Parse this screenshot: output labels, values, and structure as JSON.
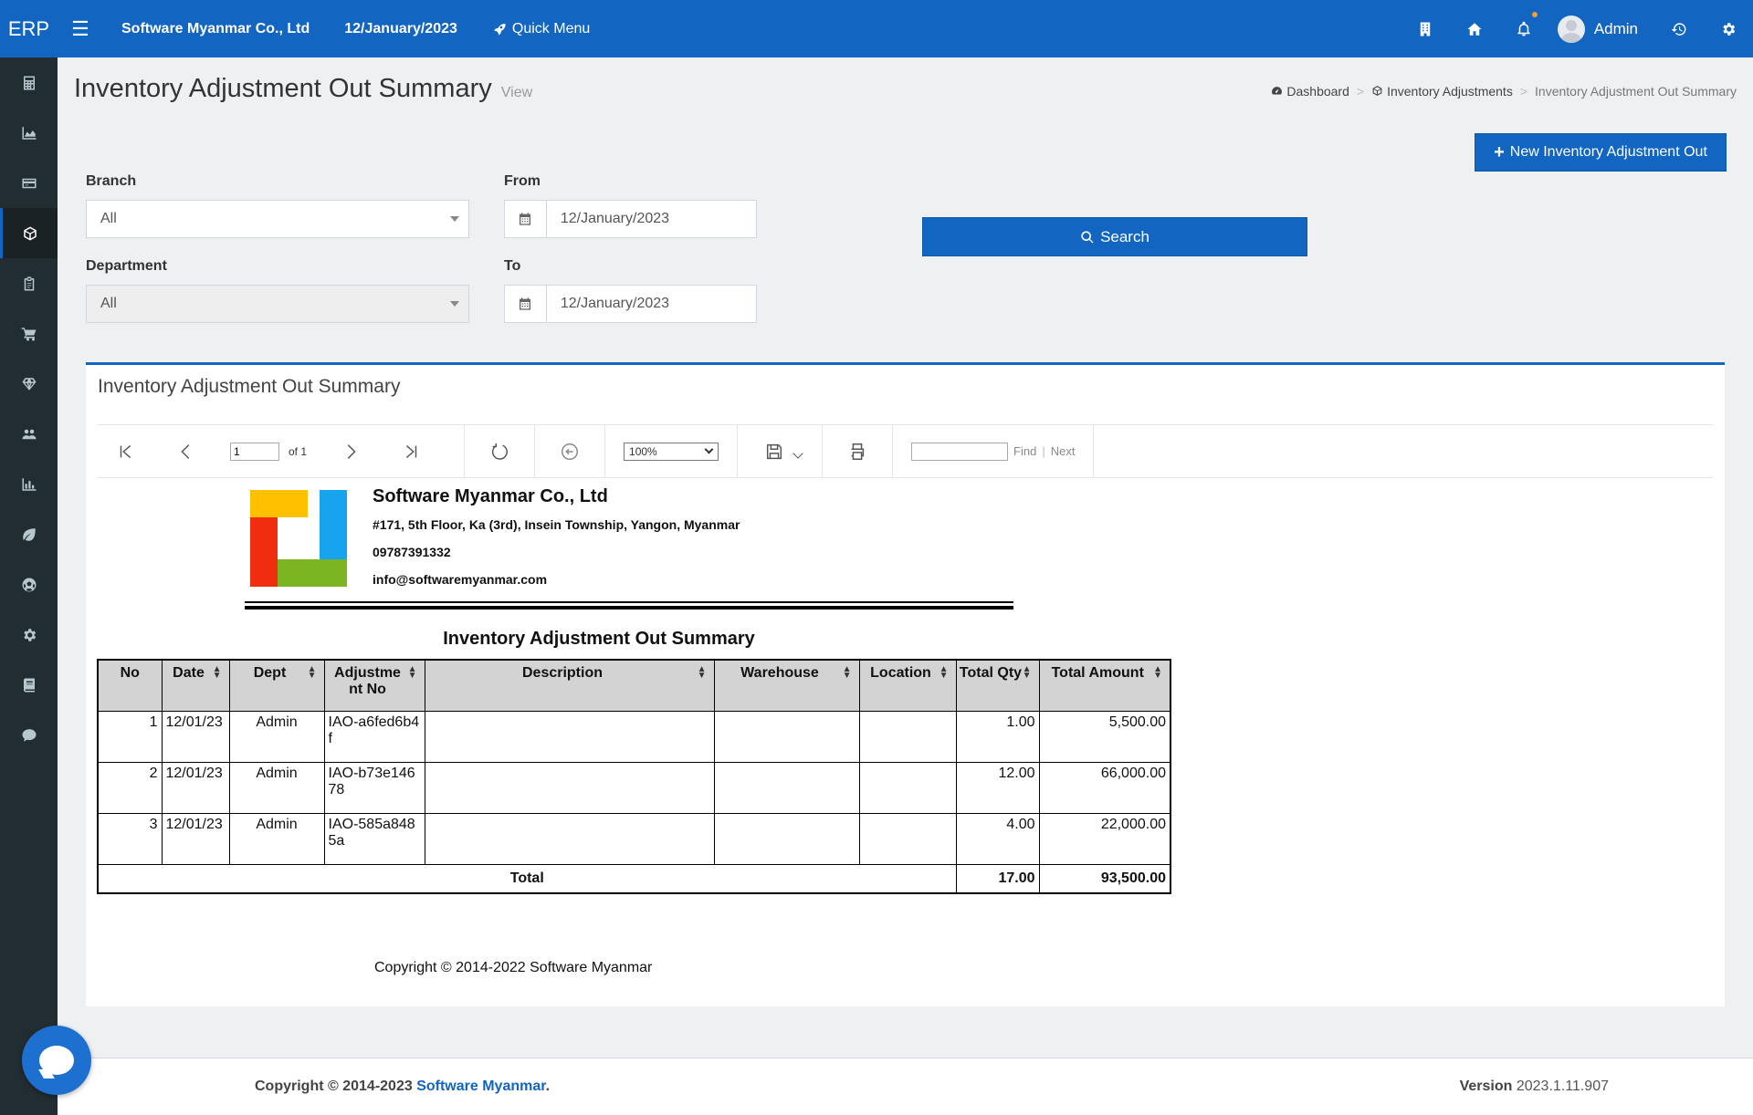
{
  "topbar": {
    "brand": "ERP",
    "company": "Software Myanmar Co., Ltd",
    "date": "12/January/2023",
    "quick_menu": "Quick Menu",
    "user": "Admin"
  },
  "page": {
    "title": "Inventory Adjustment Out Summary",
    "subtitle": "View"
  },
  "breadcrumb": {
    "items": [
      "Dashboard",
      "Inventory Adjustments",
      "Inventory Adjustment Out Summary"
    ]
  },
  "actions": {
    "new_label": "New Inventory Adjustment Out",
    "search_label": "Search"
  },
  "filters": {
    "branch_label": "Branch",
    "branch_value": "All",
    "department_label": "Department",
    "department_value": "All",
    "from_label": "From",
    "from_value": "12/January/2023",
    "to_label": "To",
    "to_value": "12/January/2023"
  },
  "box": {
    "title": "Inventory Adjustment Out Summary"
  },
  "viewer": {
    "page": "1",
    "of": "of 1",
    "zoom": "100%",
    "find": "Find",
    "next": "Next"
  },
  "report": {
    "company": "Software Myanmar Co., Ltd",
    "address": "#171, 5th Floor, Ka (3rd), Insein Township, Yangon, Myanmar",
    "phone": "09787391332",
    "email": "info@softwaremyanmar.com",
    "title": "Inventory Adjustment Out Summary",
    "columns": [
      "No",
      "Date",
      "Dept",
      "Adjustme nt No",
      "Description",
      "Warehouse",
      "Location",
      "Total Qty",
      "Total Amount"
    ],
    "rows": [
      {
        "no": "1",
        "date": "12/01/23",
        "dept": "Admin",
        "adj_no": "IAO-a6fed6b4f",
        "description": "",
        "warehouse": "",
        "location": "",
        "qty": "1.00",
        "amount": "5,500.00"
      },
      {
        "no": "2",
        "date": "12/01/23",
        "dept": "Admin",
        "adj_no": "IAO-b73e14678",
        "description": "",
        "warehouse": "",
        "location": "",
        "qty": "12.00",
        "amount": "66,000.00"
      },
      {
        "no": "3",
        "date": "12/01/23",
        "dept": "Admin",
        "adj_no": "IAO-585a8485a",
        "description": "",
        "warehouse": "",
        "location": "",
        "qty": "4.00",
        "amount": "22,000.00"
      }
    ],
    "total_label": "Total",
    "total_qty": "17.00",
    "total_amount": "93,500.00",
    "copyright": "Copyright © 2014-2022 Software Myanmar"
  },
  "footer": {
    "copyright_prefix": "Copyright © 2014-2023",
    "copyright_link": "Software Myanmar",
    "version_label": "Version",
    "version_value": "2023.1.11.907"
  },
  "colors": {
    "primary": "#1265c1",
    "sidebar": "#222d32",
    "header_cell": "#d3d3d3"
  }
}
